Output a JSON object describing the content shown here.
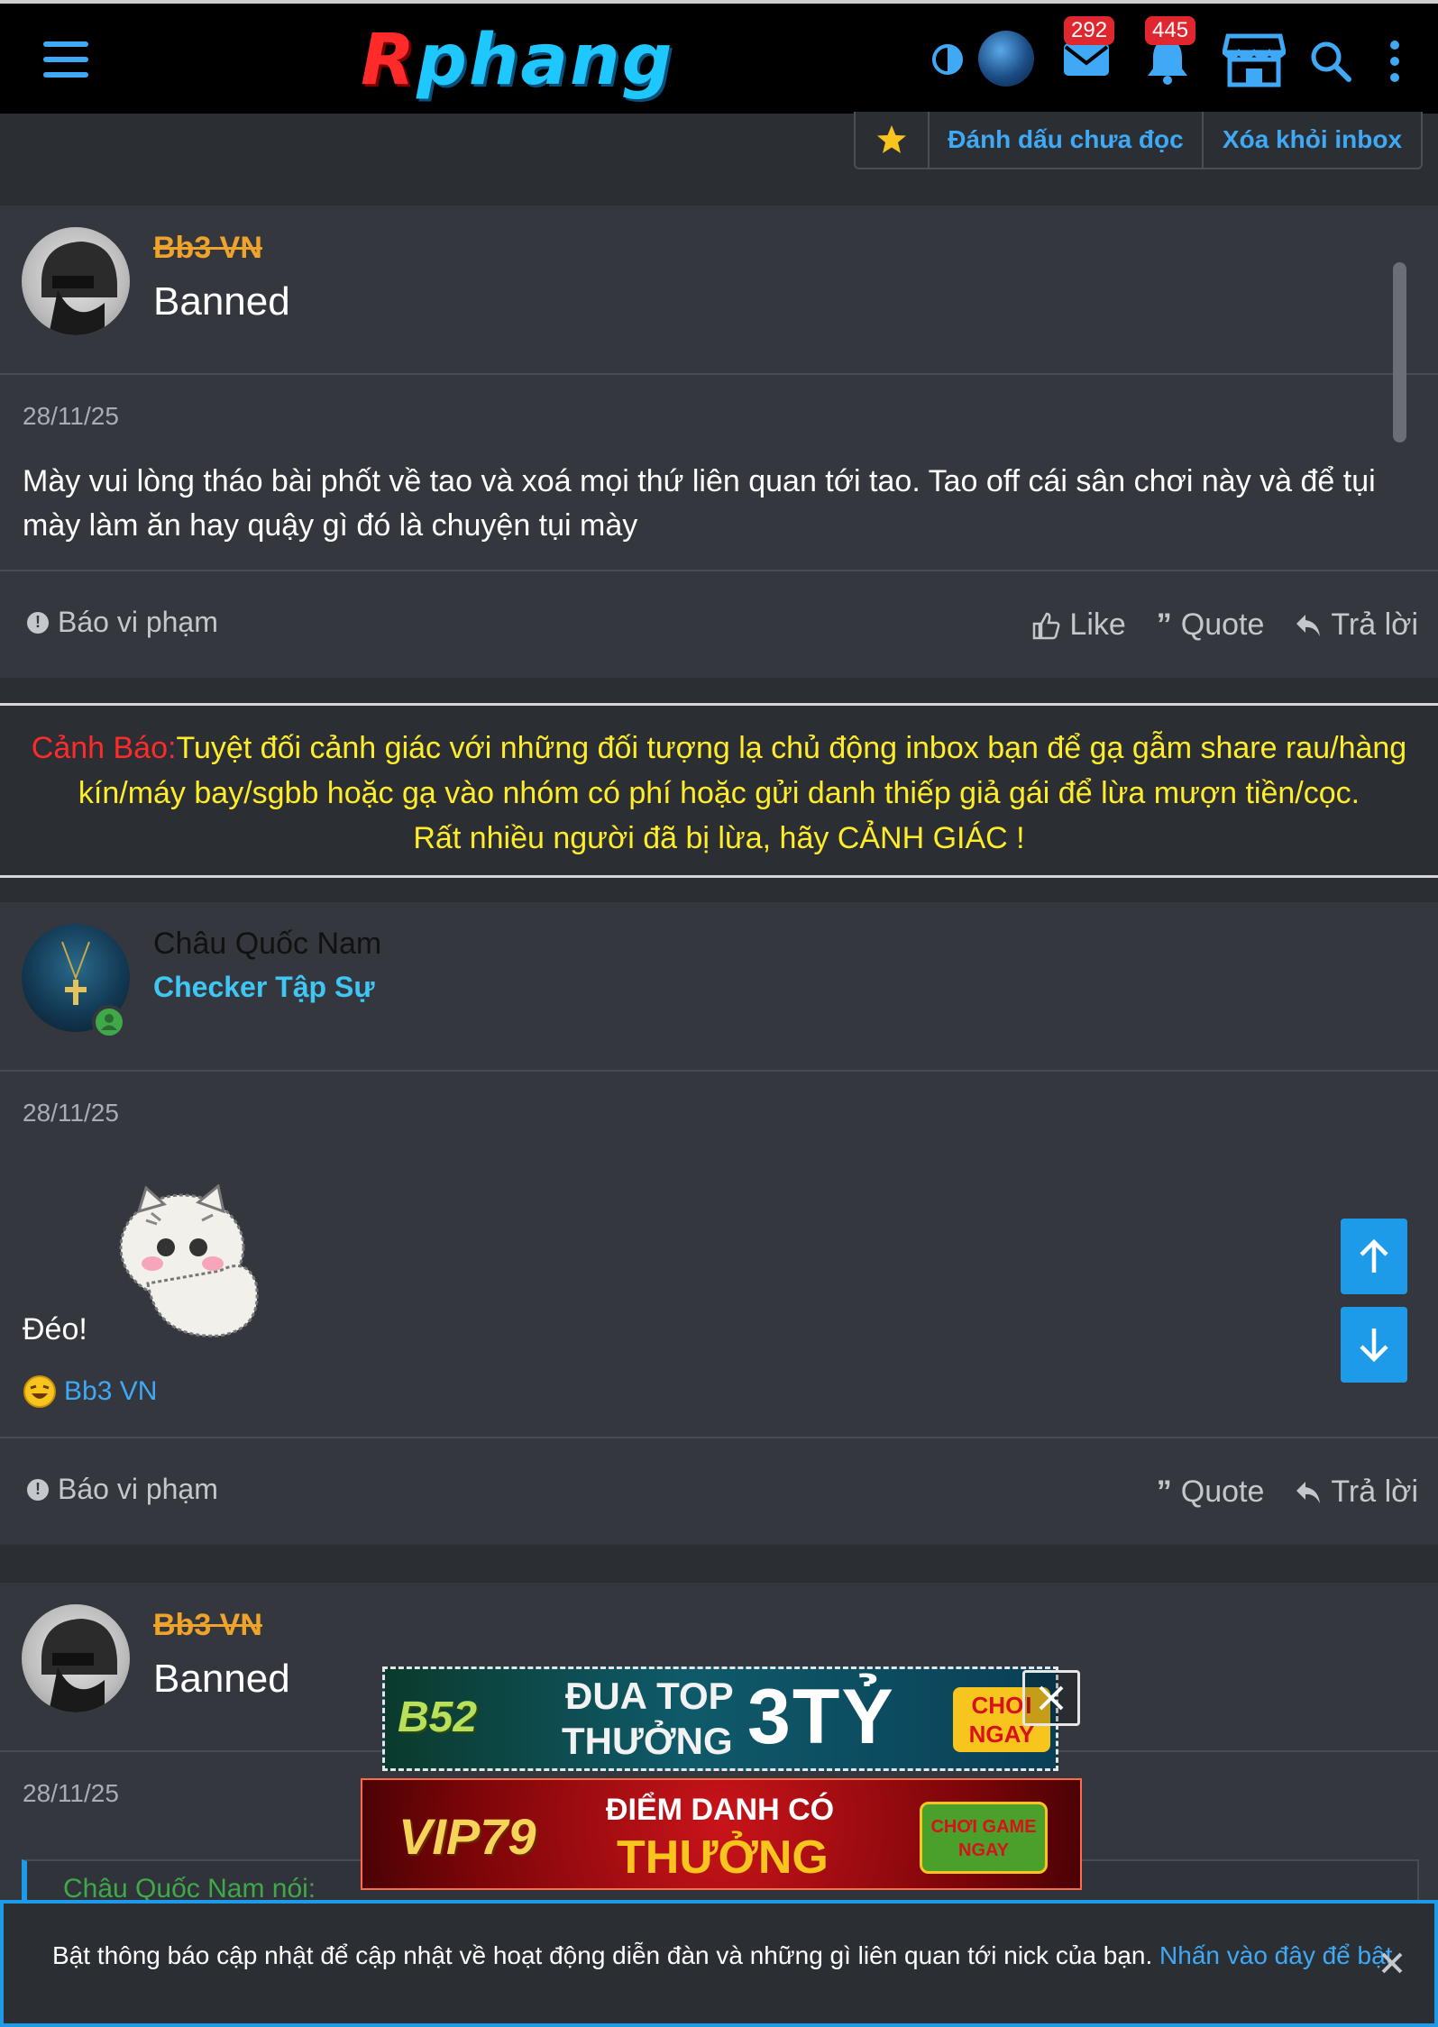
{
  "header": {
    "logo_first": "R",
    "logo_rest": "phang",
    "mail_count": "292",
    "notif_count": "445"
  },
  "thread_actions": {
    "mark_unread": "Đánh dấu chưa đọc",
    "remove_inbox": "Xóa khỏi inbox"
  },
  "messages": [
    {
      "username": "Bb3 VN",
      "user_title": "Banned",
      "date": "28/11/25",
      "text": "Mày vui lòng tháo bài phốt về tao và xoá mọi thứ liên quan tới tao. Tao off cái sân chơi này và để tụi mày làm ăn hay quậy gì đó là chuyện tụi mày",
      "report": "Báo vi phạm",
      "like": "Like",
      "quote": "Quote",
      "reply": "Trả lời"
    },
    {
      "username": "Châu Quốc Nam",
      "user_title": "Checker Tập Sự",
      "date": "28/11/25",
      "text": "Đéo!",
      "reaction_user": "Bb3 VN",
      "report": "Báo vi phạm",
      "quote": "Quote",
      "reply": "Trả lời"
    },
    {
      "username": "Bb3 VN",
      "user_title": "Banned",
      "date": "28/11/25",
      "quote_author": "Châu Quốc Nam nói:"
    }
  ],
  "warning": {
    "label": "Cảnh Báo:",
    "line1": "Tuyệt đối cảnh giác với những đối tượng lạ chủ động inbox bạn để gạ gẫm share rau/hàng",
    "line2": "kín/máy bay/sgbb hoặc gạ vào nhóm có phí hoặc gửi danh thiếp giả gái để lừa mượn tiền/cọc.",
    "line3": "Rất nhiều người đã bị lừa, hãy CẢNH GIÁC !"
  },
  "ads": {
    "ad1_brand": "B52",
    "ad1_line1": "ĐUA TOP",
    "ad1_line2": "THƯỞNG",
    "ad1_big": "3TỶ",
    "ad1_cta": "CHƠI NGAY",
    "ad2_brand": "VIP79",
    "ad2_line1": "ĐIỂM DANH CÓ",
    "ad2_line2": "THƯỞNG",
    "ad2_cta": "CHƠI GAME NGAY"
  },
  "notification": {
    "text": "Bật thông báo cập nhật để cập nhật về hoạt động diễn đàn và những gì liên quan tới nick của bạn.",
    "link": "Nhấn vào đây để bật"
  },
  "colors": {
    "accent": "#3fa9f5",
    "banned_name": "#f0a32a",
    "checker_title": "#3fc6f5",
    "warning_label": "#ff2a2a",
    "warning_text": "#ffec2a",
    "badge": "#e0262e"
  }
}
